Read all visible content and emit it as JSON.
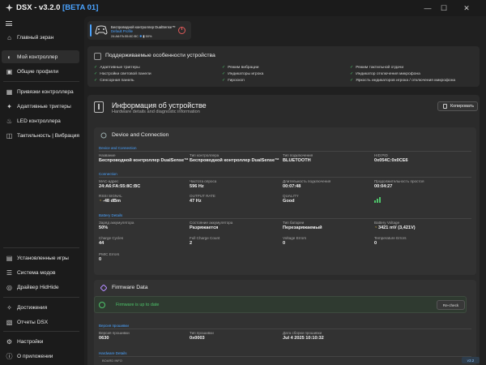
{
  "app": {
    "name": "DSX",
    "version_text": "- v3.2.0",
    "beta": "[BETA 01]",
    "version_badge": "v3.2"
  },
  "window": {
    "minimize": "—",
    "maximize": "☐",
    "close": "✕"
  },
  "icons": {
    "copy": "copy-icon",
    "ok": "check-circle-icon"
  },
  "colors": {
    "accent": "#4aa3ff",
    "ok": "#4ec46a",
    "warn": "#e0b84a",
    "power": "#e05a5a"
  },
  "sidebar": {
    "top": [
      {
        "label": "Главный экран",
        "icon": "⌂"
      },
      {
        "label": "Мой контроллер",
        "icon": "◐"
      },
      {
        "label": "Общие профили",
        "icon": "▣"
      }
    ],
    "mid": [
      {
        "label": "Привязки контроллера",
        "icon": "▦"
      },
      {
        "label": "Адаптивные триггеры",
        "icon": "✦"
      },
      {
        "label": "LED контроллера",
        "icon": "♨"
      },
      {
        "label": "Тактильность | Вибрация",
        "icon": "◫"
      }
    ],
    "bottom": [
      {
        "label": "Установленные игры",
        "icon": "▤"
      },
      {
        "label": "Система модов",
        "icon": "☰"
      },
      {
        "label": "Драйвер HidHide",
        "icon": "◎"
      }
    ],
    "footer": [
      {
        "label": "Достижения",
        "icon": "✧"
      },
      {
        "label": "Отчеты DSX",
        "icon": "▧"
      },
      {
        "label": "Настройки",
        "icon": "⚙"
      },
      {
        "label": "О приложении",
        "icon": "ⓘ"
      }
    ]
  },
  "controller_card": {
    "name": "Беспроводной контроллер DualSense™",
    "profile": "Default Profile",
    "mac": "24:A6:FA:55:8C:BC",
    "battery": "50%"
  },
  "features": {
    "title": "Поддерживаемые особенности устройства",
    "items": [
      "Адаптивные триггеры",
      "Режим вибрации",
      "Режим тактильной отдачи",
      "Настройки световой панели",
      "Индикаторы игрока",
      "Индикатор отключения микрофона",
      "Сенсорная панель",
      "Гироскоп",
      "Яркость индикаторов игрока / отключения микрофона"
    ]
  },
  "info": {
    "title": "Информация об устройстве",
    "subtitle": "Hardware details and diagnostic information",
    "copy_label": "Копировать"
  },
  "device_connection": {
    "title": "Device and Connection",
    "groups": {
      "dc": "Device and Connection",
      "conn": "Connection",
      "battery": "Battery Details"
    },
    "fields": {
      "name_label": "Название",
      "name_value": "Беспроводной контроллер DualSense™",
      "type_label": "Тип контроллера",
      "type_value": "Беспроводной контроллер DualSense™",
      "conn_type_label": "Тип подключения",
      "conn_type_value": "BLUETOOTH",
      "hid_label": "HID:PID",
      "hid_value": "0x054C:0x0CE6",
      "mac_label": "MAC-адрес",
      "mac_value": "24:A6:FA:55:8C:BC",
      "poll_label": "Частота опроса",
      "poll_value": "596 Hz",
      "dur_label": "Длительность подключения",
      "dur_value": "00:07:48",
      "pl_label": "Продолжительность простоя",
      "pl_value": "00:04:27",
      "rssi_label": "RSSI SIGNAL",
      "rssi_value": "-48 dBm",
      "out_label": "OUTPUT RATE",
      "out_value": "47 Hz",
      "q_label": "QUALITY",
      "q_value": "Good",
      "charge_label": "Заряд аккумулятора",
      "charge_value": "50%",
      "state_label": "Состояние аккумулятора",
      "state_value": "Разряжается",
      "btype_label": "Тип батареи",
      "btype_value": "Перезаряжаемый",
      "volt_label": "Battery Voltage",
      "volt_value": "3421 mV (3,421V)",
      "cycles_label": "Charge Cycles",
      "cycles_value": "44",
      "full_label": "Full Charge Count",
      "full_value": "2",
      "verr_label": "Voltage Errors",
      "verr_value": "0",
      "terr_label": "Temperature Errors",
      "terr_value": "0",
      "pmic_label": "PMIC Errors",
      "pmic_value": "0"
    }
  },
  "firmware": {
    "title": "Firmware Data",
    "status": "Firmware is up to date",
    "recheck_label": "Re-check",
    "group_title": "Версия прошивки",
    "fw_label": "Версия прошивки",
    "fw_value": "0630",
    "fwtype_label": "Тип прошивки",
    "fwtype_value": "0x0003",
    "date_label": "Дата сборки прошивки",
    "date_value": "Jul  4 2025 10:10:32",
    "hw_group": "Hardware Details",
    "board_label": "BOARD INFO"
  }
}
